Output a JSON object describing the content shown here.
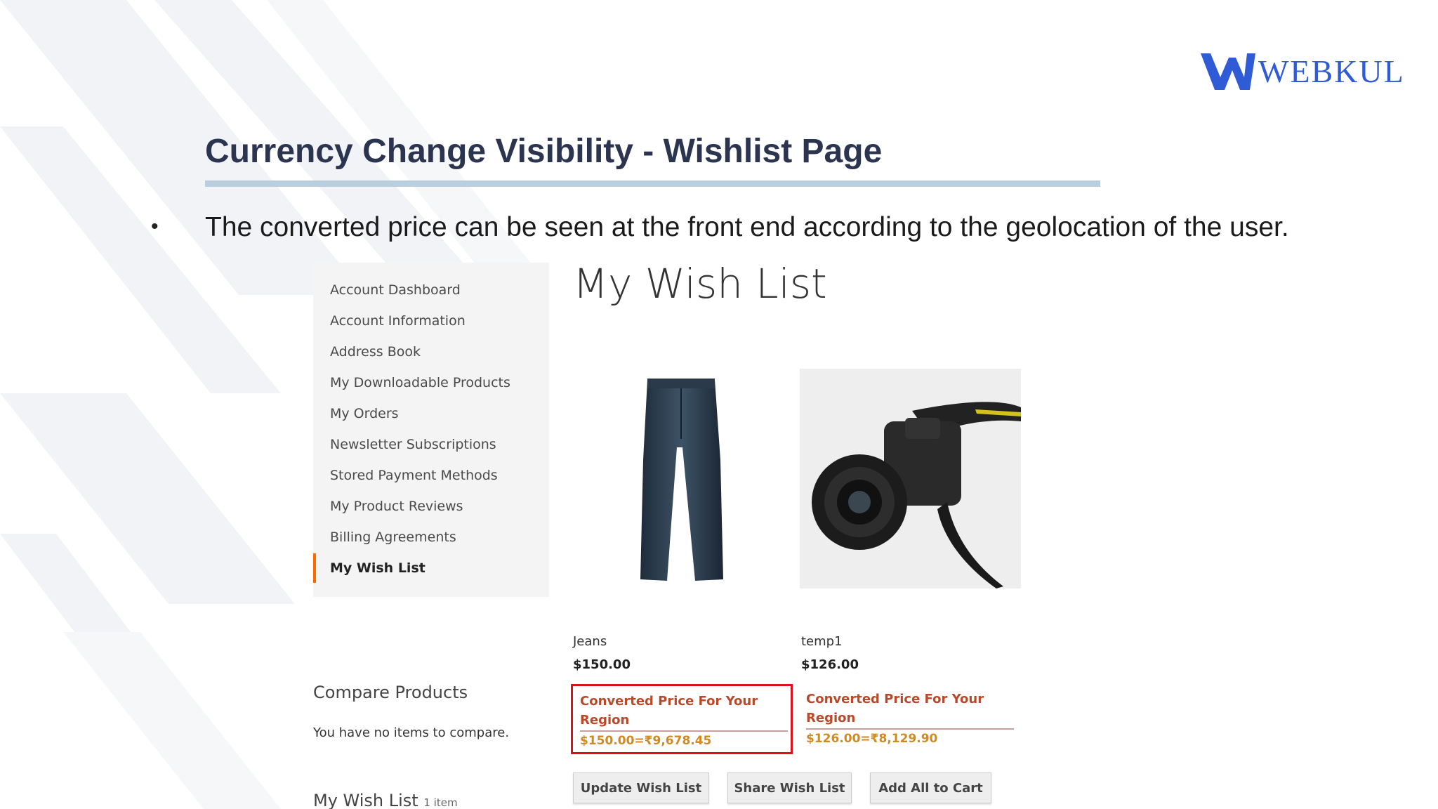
{
  "brand": {
    "logo_text": "WEBKUL",
    "accent": "#2f5bd6"
  },
  "slide": {
    "title": "Currency Change Visibility - Wishlist Page",
    "bullet_symbol": "•",
    "bullet": "The converted price can be seen at the front end according to the geolocation of the user."
  },
  "sidebar": {
    "items": [
      {
        "label": "Account Dashboard"
      },
      {
        "label": "Account Information"
      },
      {
        "label": "Address Book"
      },
      {
        "label": "My Downloadable Products"
      },
      {
        "label": "My Orders"
      },
      {
        "label": "Newsletter Subscriptions"
      },
      {
        "label": "Stored Payment Methods"
      },
      {
        "label": "My Product Reviews"
      },
      {
        "label": "Billing Agreements"
      },
      {
        "label": "My Wish List"
      }
    ],
    "active_color": "#ff6a00"
  },
  "wishlist": {
    "title": "My Wish List",
    "products": [
      {
        "name": "Jeans",
        "price": "$150.00",
        "converted_label": "Converted Price For Your Region",
        "converted_value": "$150.00=₹9,678.45"
      },
      {
        "name": "temp1",
        "price": "$126.00",
        "converted_label": "Converted Price For Your Region",
        "converted_value": "$126.00=₹8,129.90"
      }
    ],
    "buttons": {
      "update": "Update Wish List",
      "share": "Share Wish List",
      "add_all": "Add All to Cart"
    }
  },
  "compare": {
    "title": "Compare Products",
    "empty": "You have no items to compare."
  },
  "mini_wishlist": {
    "title": "My Wish List",
    "count": "1 item"
  }
}
